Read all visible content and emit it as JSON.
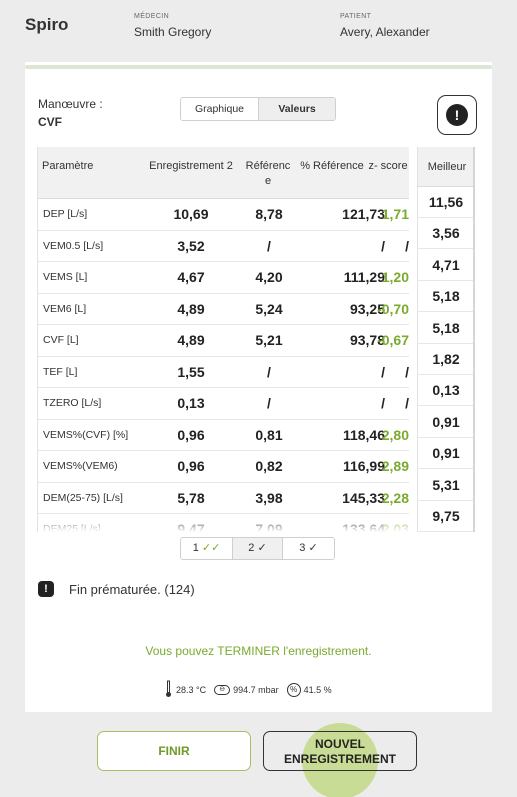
{
  "header": {
    "app_title": "Spiro",
    "doctor_label": "MÉDECIN",
    "doctor_name": "Smith Gregory",
    "patient_label": "PATIENT",
    "patient_name": "Avery, Alexander"
  },
  "maneuvre": {
    "label": "Manœuvre :",
    "value": "CVF"
  },
  "view_toggle": {
    "graph_label": "Graphique",
    "values_label": "Valeurs",
    "selected": "Valeurs"
  },
  "table": {
    "headers": {
      "param": "Paramètre",
      "recording": "Enregistrement 2",
      "reference": "Référenc e",
      "pct_reference": "% Référence",
      "zscore": "z- score"
    },
    "rows": [
      {
        "param": "DEP [L/s]",
        "recording": "10,69",
        "reference": "8,78",
        "pct": "121,73",
        "z": "1,71",
        "z_color": "green"
      },
      {
        "param": "VEM0.5 [L/s]",
        "recording": "3,52",
        "reference": "/",
        "pct": "/",
        "z": "/",
        "z_color": "dark"
      },
      {
        "param": "VEMS [L]",
        "recording": "4,67",
        "reference": "4,20",
        "pct": "111,29",
        "z": "1,20",
        "z_color": "green"
      },
      {
        "param": "VEM6 [L]",
        "recording": "4,89",
        "reference": "5,24",
        "pct": "93,25",
        "z": "-0,70",
        "z_color": "green"
      },
      {
        "param": "CVF [L]",
        "recording": "4,89",
        "reference": "5,21",
        "pct": "93,78",
        "z": "-0,67",
        "z_color": "green"
      },
      {
        "param": "TEF [L]",
        "recording": "1,55",
        "reference": "/",
        "pct": "/",
        "z": "/",
        "z_color": "dark"
      },
      {
        "param": "TZERO [L/s]",
        "recording": "0,13",
        "reference": "/",
        "pct": "/",
        "z": "/",
        "z_color": "dark"
      },
      {
        "param": "VEMS%(CVF) [%]",
        "recording": "0,96",
        "reference": "0,81",
        "pct": "118,46",
        "z": "2,80",
        "z_color": "green"
      },
      {
        "param": "VEMS%(VEM6)",
        "recording": "0,96",
        "reference": "0,82",
        "pct": "116,99",
        "z": "2,89",
        "z_color": "green"
      },
      {
        "param": "DEM(25-75) [L/s]",
        "recording": "5,78",
        "reference": "3,98",
        "pct": "145,33",
        "z": "2,28",
        "z_color": "green"
      },
      {
        "param": "DEM25 [L/s]",
        "recording": "9,47",
        "reference": "7,09",
        "pct": "133,64",
        "z": "2,03",
        "z_color": "green"
      }
    ]
  },
  "best": {
    "header": "Meilleur",
    "values": [
      "11,56",
      "3,56",
      "4,71",
      "5,18",
      "5,18",
      "1,82",
      "0,13",
      "0,91",
      "0,91",
      "5,31",
      "9,75"
    ]
  },
  "recordings_pager": {
    "items": [
      {
        "label": "1",
        "check": "✓✓",
        "check_color": "green"
      },
      {
        "label": "2",
        "check": "✓",
        "check_color": "dark"
      },
      {
        "label": "3",
        "check": "✓",
        "check_color": "dark"
      }
    ],
    "selected": "2"
  },
  "warning": {
    "icon": "exclamation-icon",
    "text": "Fin prématurée. (124)"
  },
  "finish_message": "Vous pouvez TERMINER l'enregistrement.",
  "environment": {
    "temperature": "28.3 °C",
    "pressure": "994.7 mbar",
    "humidity": "41.5 %"
  },
  "buttons": {
    "finish_label": "FINIR",
    "new_recording_line1": "NOUVEL",
    "new_recording_line2": "ENREGISTREMENT"
  },
  "colors": {
    "accent_green": "#7aaa2e",
    "card_background": "#ffffff",
    "page_background": "#ececec"
  }
}
